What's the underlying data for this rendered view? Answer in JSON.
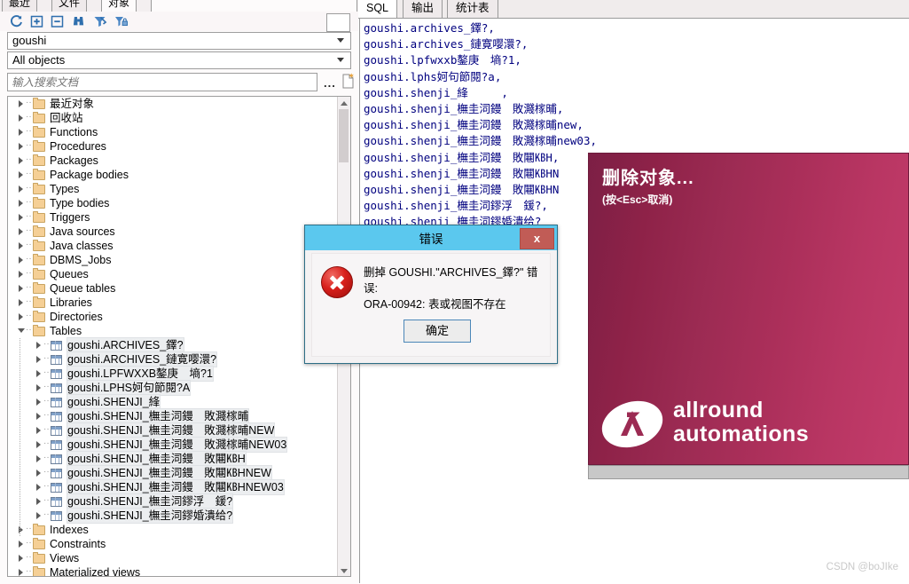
{
  "left": {
    "tabs": [
      {
        "label": "最近",
        "active": false
      },
      {
        "label": "文件",
        "active": false
      },
      {
        "label": "对象",
        "active": true
      }
    ],
    "toolbar": {
      "refresh": "refresh-icon",
      "expand": "expand-all-icon",
      "collapse": "collapse-all-icon",
      "find": "binoculars-find-icon",
      "filter": "filter-icon",
      "filter_lock": "filter-lock-icon"
    },
    "schema_combo": {
      "value": "goushi"
    },
    "filter_combo": {
      "value": "All objects"
    },
    "search": {
      "placeholder": "输入搜索文档",
      "value": "",
      "ellipsis": "...",
      "newdoc_icon": "new-document-icon"
    },
    "tree": [
      {
        "label": "最近对象",
        "icon": "folder",
        "indent": 0,
        "state": "closed",
        "selected": false
      },
      {
        "label": "回收站",
        "icon": "folder",
        "indent": 0,
        "state": "closed",
        "selected": false
      },
      {
        "label": "Functions",
        "icon": "folder",
        "indent": 0,
        "state": "closed",
        "selected": false
      },
      {
        "label": "Procedures",
        "icon": "folder",
        "indent": 0,
        "state": "closed",
        "selected": false
      },
      {
        "label": "Packages",
        "icon": "folder",
        "indent": 0,
        "state": "closed",
        "selected": false
      },
      {
        "label": "Package bodies",
        "icon": "folder",
        "indent": 0,
        "state": "closed",
        "selected": false
      },
      {
        "label": "Types",
        "icon": "folder",
        "indent": 0,
        "state": "closed",
        "selected": false
      },
      {
        "label": "Type bodies",
        "icon": "folder",
        "indent": 0,
        "state": "closed",
        "selected": false
      },
      {
        "label": "Triggers",
        "icon": "folder",
        "indent": 0,
        "state": "closed",
        "selected": false
      },
      {
        "label": "Java sources",
        "icon": "folder",
        "indent": 0,
        "state": "closed",
        "selected": false
      },
      {
        "label": "Java classes",
        "icon": "folder",
        "indent": 0,
        "state": "closed",
        "selected": false
      },
      {
        "label": "DBMS_Jobs",
        "icon": "folder",
        "indent": 0,
        "state": "closed",
        "selected": false
      },
      {
        "label": "Queues",
        "icon": "folder",
        "indent": 0,
        "state": "closed",
        "selected": false
      },
      {
        "label": "Queue tables",
        "icon": "folder",
        "indent": 0,
        "state": "closed",
        "selected": false
      },
      {
        "label": "Libraries",
        "icon": "folder",
        "indent": 0,
        "state": "closed",
        "selected": false
      },
      {
        "label": "Directories",
        "icon": "folder",
        "indent": 0,
        "state": "closed",
        "selected": false
      },
      {
        "label": "Tables",
        "icon": "folder",
        "indent": 0,
        "state": "open",
        "selected": false
      },
      {
        "label": "goushi.ARCHIVES_鐸?",
        "icon": "table",
        "indent": 1,
        "state": "closed",
        "selected": true
      },
      {
        "label": "goushi.ARCHIVES_鏈寛嘤澴?",
        "icon": "table",
        "indent": 1,
        "state": "closed",
        "selected": true
      },
      {
        "label": "goushi.LPFWXXB鏊庚　墒?1",
        "icon": "table",
        "indent": 1,
        "state": "closed",
        "selected": true
      },
      {
        "label": "goushi.LPHS妸句節閱?A",
        "icon": "table",
        "indent": 1,
        "state": "closed",
        "selected": true
      },
      {
        "label": "goushi.SHENJI_綘",
        "icon": "table",
        "indent": 1,
        "state": "closed",
        "selected": true
      },
      {
        "label": "goushi.SHENJI_橅圭泀鏝　敗濺榢晡",
        "icon": "table",
        "indent": 1,
        "state": "closed",
        "selected": true
      },
      {
        "label": "goushi.SHENJI_橅圭泀鏝　敗濺榢晡NEW",
        "icon": "table",
        "indent": 1,
        "state": "closed",
        "selected": true
      },
      {
        "label": "goushi.SHENJI_橅圭泀鏝　敗濺榢晡NEW03",
        "icon": "table",
        "indent": 1,
        "state": "closed",
        "selected": true
      },
      {
        "label": "goushi.SHENJI_橅圭泀鏝　敗闀㎅H",
        "icon": "table",
        "indent": 1,
        "state": "closed",
        "selected": true
      },
      {
        "label": "goushi.SHENJI_橅圭泀鏝　敗闀㎅HNEW",
        "icon": "table",
        "indent": 1,
        "state": "closed",
        "selected": true
      },
      {
        "label": "goushi.SHENJI_橅圭泀鏝　敗闀㎅HNEW03",
        "icon": "table",
        "indent": 1,
        "state": "closed",
        "selected": true
      },
      {
        "label": "goushi.SHENJI_橅圭泀鏐浮　鍰?",
        "icon": "table",
        "indent": 1,
        "state": "closed",
        "selected": true
      },
      {
        "label": "goushi.SHENJI_橅圭泀鏐婚潰给?",
        "icon": "table",
        "indent": 1,
        "state": "closed",
        "selected": true
      },
      {
        "label": "Indexes",
        "icon": "folder",
        "indent": 0,
        "state": "closed",
        "selected": false
      },
      {
        "label": "Constraints",
        "icon": "folder",
        "indent": 0,
        "state": "closed",
        "selected": false
      },
      {
        "label": "Views",
        "icon": "folder",
        "indent": 0,
        "state": "closed",
        "selected": false
      },
      {
        "label": "Materialized views",
        "icon": "folder",
        "indent": 0,
        "state": "closed",
        "selected": false
      }
    ]
  },
  "right": {
    "tabs": [
      {
        "label": "SQL",
        "active": true
      },
      {
        "label": "输出",
        "active": false
      },
      {
        "label": "统计表",
        "active": false
      }
    ],
    "sql_lines": [
      "goushi.archives_鐸?,",
      "goushi.archives_鏈寛嘤澴?,",
      "goushi.lpfwxxb鏊庚　墒?1,",
      "goushi.lphs妸句節閱?a,",
      "goushi.shenji_綘　　　,",
      "goushi.shenji_橅圭泀鏝　敗濺榢晡,",
      "goushi.shenji_橅圭泀鏝　敗濺榢晡new,",
      "goushi.shenji_橅圭泀鏝　敗濺榢晡new03,",
      "goushi.shenji_橅圭泀鏝　敗闀㎅H,",
      "goushi.shenji_橅圭泀鏝　敗闀㎅HN",
      "goushi.shenji_橅圭泀鏝　敗闀㎅HN",
      "goushi.shenji_橅圭泀鏐浮　鍰?,",
      "goushi.shenji_橅圭泀鏐婚潰给?"
    ]
  },
  "splash": {
    "title": "删除对象...",
    "subtitle": "(按<Esc>取消)",
    "logo_line1": "allround",
    "logo_line2": "automations",
    "logo_icon": "allround-automations-logo"
  },
  "dialog": {
    "title": "错误",
    "close_label": "x",
    "message_line1": "删掉 GOUSHI.\"ARCHIVES_鐸?\" 错误:",
    "message_line2": "ORA-00942: 表或视图不存在",
    "ok_label": "确定",
    "error_icon": "error-circle-x-icon",
    "titlebar_color": "#5bc8ee",
    "close_color": "#c15c56"
  },
  "watermark": {
    "text": "CSDN @boJIke"
  }
}
